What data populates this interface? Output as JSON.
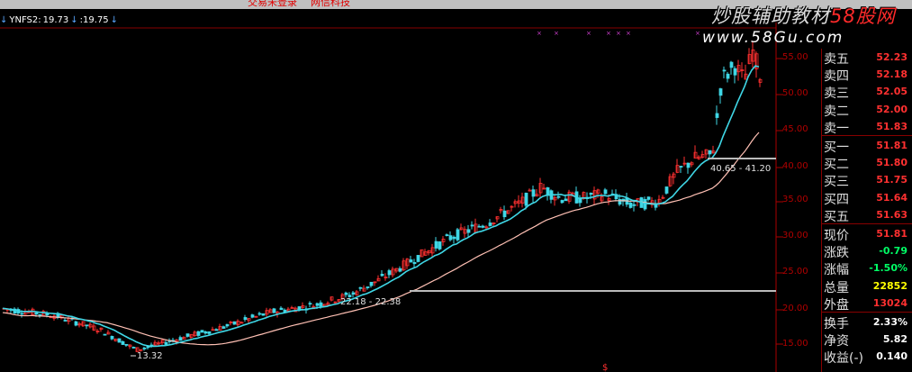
{
  "window": {
    "title_left": "交易未登录",
    "title_right": "网信科技"
  },
  "indicator": {
    "name": "YNFS2:",
    "value1": "19.73",
    "value2": ":19.75"
  },
  "watermark": {
    "brand_cn": "炒股辅助教材",
    "brand_site": "58股网",
    "url": "www.58Gu.com"
  },
  "price_axis": {
    "labels": [
      "55.00",
      "50.00",
      "45.00",
      "40.00",
      "35.00",
      "30.00",
      "25.00",
      "20.00",
      "15.00"
    ]
  },
  "annotations": {
    "low_label": "13.32",
    "support_label": "22.18 - 22.38",
    "upper_label": "40.65 - 41.20",
    "bottom_marker": "$"
  },
  "quote_panel": {
    "rows": [
      {
        "label": "卖五",
        "value": "52.23",
        "color": "#ff3030"
      },
      {
        "label": "卖四",
        "value": "52.18",
        "color": "#ff3030"
      },
      {
        "label": "卖三",
        "value": "52.05",
        "color": "#ff3030"
      },
      {
        "label": "卖二",
        "value": "52.00",
        "color": "#ff3030"
      },
      {
        "label": "卖一",
        "value": "51.83",
        "color": "#ff3030"
      },
      {
        "label": "买一",
        "value": "51.81",
        "color": "#ff3030"
      },
      {
        "label": "买二",
        "value": "51.80",
        "color": "#ff3030"
      },
      {
        "label": "买三",
        "value": "51.75",
        "color": "#ff3030"
      },
      {
        "label": "买四",
        "value": "51.64",
        "color": "#ff3030"
      },
      {
        "label": "买五",
        "value": "51.63",
        "color": "#ff3030"
      },
      {
        "label": "现价",
        "value": "51.81",
        "color": "#ff3030"
      },
      {
        "label": "涨跌",
        "value": "-0.79",
        "color": "#00ff66"
      },
      {
        "label": "涨幅",
        "value": "-1.50%",
        "color": "#00ff66"
      },
      {
        "label": "总量",
        "value": "22852",
        "color": "#ffff00"
      },
      {
        "label": "外盘",
        "value": "13024",
        "color": "#ff3030"
      },
      {
        "label": "换手",
        "value": "2.33%",
        "color": "#ffffff"
      },
      {
        "label": "净资",
        "value": "5.82",
        "color": "#ffffff"
      },
      {
        "label": "收益(-)",
        "value": "0.140",
        "color": "#ffffff"
      }
    ]
  },
  "colors": {
    "ma_short": "#3fd7e6",
    "ma_long": "#ffc0b4",
    "candle_up": "#ff3030",
    "candle_down": "#3fd7e6",
    "grid": "#7a0000"
  }
}
